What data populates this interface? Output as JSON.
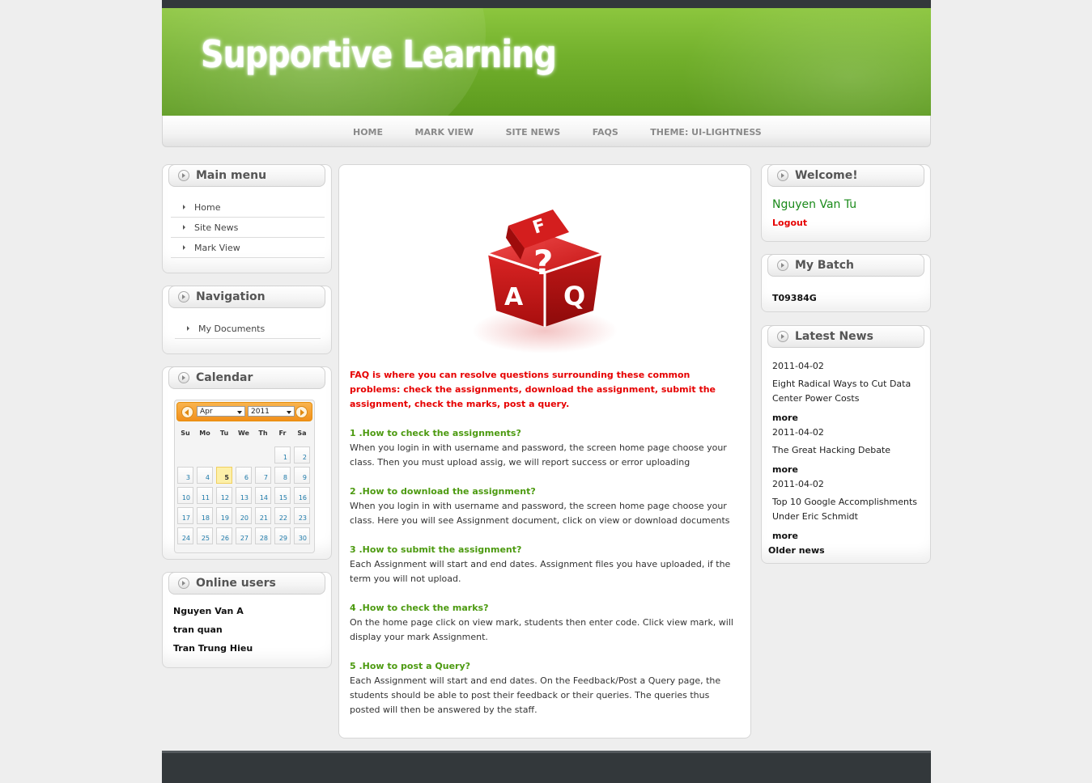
{
  "site": {
    "title": "Supportive Learning"
  },
  "nav": {
    "items": [
      {
        "label": "HOME"
      },
      {
        "label": "MARK VIEW"
      },
      {
        "label": "SITE NEWS"
      },
      {
        "label": "FAQS"
      },
      {
        "label": "THEME: UI-LIGHTNESS"
      }
    ]
  },
  "main_menu": {
    "title": "Main menu",
    "items": [
      {
        "label": "Home"
      },
      {
        "label": "Site News"
      },
      {
        "label": "Mark View"
      }
    ]
  },
  "navigation": {
    "title": "Navigation",
    "items": [
      {
        "label": "My Documents"
      }
    ]
  },
  "calendar": {
    "title": "Calendar",
    "month": "Apr",
    "year": "2011",
    "weekdays": [
      "Su",
      "Mo",
      "Tu",
      "We",
      "Th",
      "Fr",
      "Sa"
    ],
    "first_weekday": 5,
    "days": 30,
    "today": 5
  },
  "online_users": {
    "title": "Online users",
    "users": [
      "Nguyen Van A",
      "tran quan",
      "Tran Trung Hieu"
    ]
  },
  "content": {
    "image_letters": [
      "F",
      "A",
      "?",
      "Q"
    ],
    "intro": "FAQ is where you can resolve questions surrounding these common problems: check the assignments, download the assignment, submit the assignment, check the marks, post a query.",
    "faqs": [
      {
        "q": "1 .How to check the assignments?",
        "a": "When you login in with username and password, the screen home page choose your class. Then you must upload assig, we will report success or error uploading"
      },
      {
        "q": "2 .How to download the assignment?",
        "a": "When you login in with username and password, the screen home page choose your class. Here you will see Assignment document, click on view or download documents"
      },
      {
        "q": "3 .How to submit the assignment?",
        "a": "Each Assignment will start and end dates. Assignment files you have uploaded, if the term you will not upload."
      },
      {
        "q": "4 .How to check the marks?",
        "a": "On the home page click on view mark, students then enter code. Click view mark, will display your mark Assignment."
      },
      {
        "q": "5 .How to post a Query?",
        "a": "Each Assignment will start and end dates. On the Feedback/Post a Query page, the students should be able to post their feedback or their queries. The queries thus posted will then be answered by the staff."
      }
    ]
  },
  "welcome": {
    "title": "Welcome!",
    "user_name": "Nguyen Van Tu",
    "logout_label": "Logout"
  },
  "batch": {
    "title": "My Batch",
    "code": "T09384G"
  },
  "latest_news": {
    "title": "Latest News",
    "items": [
      {
        "date": "2011-04-02",
        "title": "Eight Radical Ways to Cut Data Center Power Costs",
        "more": "more"
      },
      {
        "date": "2011-04-02",
        "title": "The Great Hacking Debate",
        "more": "more"
      },
      {
        "date": "2011-04-02",
        "title": "Top 10 Google Accomplishments Under Eric Schmidt",
        "more": "more"
      }
    ],
    "older_label": "Older news"
  },
  "colors": {
    "banner_green": "#72b02c",
    "intro_red": "#e60000",
    "question_green": "#4c9a10",
    "welcome_name_green": "#1a8a1a",
    "calendar_orange": "#f1901b",
    "dark_bar": "#33383b"
  }
}
